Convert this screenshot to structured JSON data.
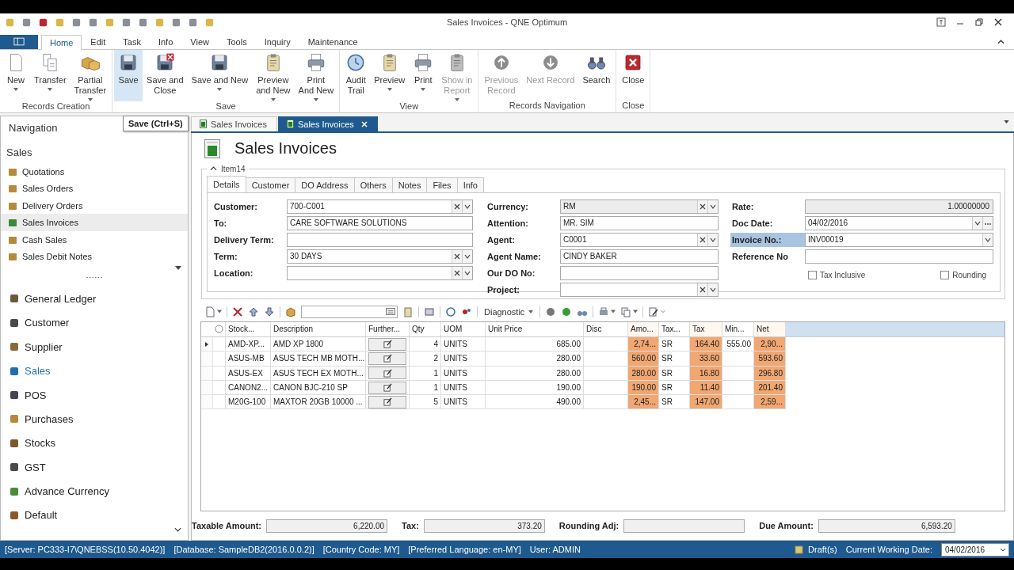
{
  "window": {
    "title": "Sales Invoices - QNE Optimum"
  },
  "ribbon_tabs": [
    {
      "label": "Home",
      "selected": true
    },
    {
      "label": "Edit",
      "selected": false
    },
    {
      "label": "Task",
      "selected": false
    },
    {
      "label": "Info",
      "selected": false
    },
    {
      "label": "View",
      "selected": false
    },
    {
      "label": "Tools",
      "selected": false
    },
    {
      "label": "Inquiry",
      "selected": false
    },
    {
      "label": "Maintenance",
      "selected": false
    }
  ],
  "ribbon_groups": [
    {
      "label": "Records Creation",
      "buttons": [
        {
          "lines": [
            "New"
          ],
          "dropdown": true,
          "disabled": false,
          "hovered": false
        },
        {
          "lines": [
            "Transfer"
          ],
          "dropdown": true,
          "disabled": false,
          "hovered": false
        },
        {
          "lines": [
            "Partial",
            "Transfer"
          ],
          "dropdown": true,
          "disabled": false,
          "hovered": false
        }
      ]
    },
    {
      "label": "Save",
      "buttons": [
        {
          "lines": [
            "Save"
          ],
          "dropdown": false,
          "disabled": false,
          "hovered": true
        },
        {
          "lines": [
            "Save and",
            "Close"
          ],
          "dropdown": false,
          "disabled": false,
          "hovered": false
        },
        {
          "lines": [
            "Save and New"
          ],
          "dropdown": true,
          "disabled": false,
          "hovered": false
        },
        {
          "lines": [
            "Preview",
            "and New"
          ],
          "dropdown": true,
          "disabled": false,
          "hovered": false
        },
        {
          "lines": [
            "Print",
            "And New"
          ],
          "dropdown": true,
          "disabled": false,
          "hovered": false
        }
      ]
    },
    {
      "label": "View",
      "buttons": [
        {
          "lines": [
            "Audit",
            "Trail"
          ],
          "dropdown": false,
          "disabled": false,
          "hovered": false
        },
        {
          "lines": [
            "Preview"
          ],
          "dropdown": true,
          "disabled": false,
          "hovered": false
        },
        {
          "lines": [
            "Print"
          ],
          "dropdown": true,
          "disabled": false,
          "hovered": false
        },
        {
          "lines": [
            "Show in",
            "Report"
          ],
          "dropdown": true,
          "disabled": true,
          "hovered": false
        }
      ]
    },
    {
      "label": "Records Navigation",
      "buttons": [
        {
          "lines": [
            "Previous",
            "Record"
          ],
          "dropdown": false,
          "disabled": true,
          "hovered": false
        },
        {
          "lines": [
            "Next Record"
          ],
          "dropdown": false,
          "disabled": true,
          "hovered": false
        },
        {
          "lines": [
            "Search"
          ],
          "dropdown": false,
          "disabled": false,
          "hovered": false
        }
      ]
    },
    {
      "label": "Close",
      "buttons": [
        {
          "lines": [
            "Close"
          ],
          "dropdown": false,
          "disabled": false,
          "hovered": false
        }
      ]
    }
  ],
  "tooltip": "Save (Ctrl+S)",
  "doc_tabs": [
    {
      "label": "Sales Invoices",
      "selected": false
    },
    {
      "label": "Sales Invoices",
      "selected": true
    }
  ],
  "navigation": {
    "title": "Navigation",
    "section": "Sales",
    "items": [
      {
        "label": "Quotations",
        "selected": false
      },
      {
        "label": "Sales Orders",
        "selected": false
      },
      {
        "label": "Delivery Orders",
        "selected": false
      },
      {
        "label": "Sales Invoices",
        "selected": true
      },
      {
        "label": "Cash Sales",
        "selected": false
      },
      {
        "label": "Sales Debit Notes",
        "selected": false
      }
    ],
    "modules": [
      {
        "label": "General Ledger",
        "selected": false
      },
      {
        "label": "Customer",
        "selected": false
      },
      {
        "label": "Supplier",
        "selected": false
      },
      {
        "label": "Sales",
        "selected": true
      },
      {
        "label": "POS",
        "selected": false
      },
      {
        "label": "Purchases",
        "selected": false
      },
      {
        "label": "Stocks",
        "selected": false
      },
      {
        "label": "GST",
        "selected": false
      },
      {
        "label": "Advance Currency",
        "selected": false
      },
      {
        "label": "Default",
        "selected": false
      }
    ]
  },
  "page_title": "Sales Invoices",
  "form": {
    "group_title": "Item14",
    "expanded": true,
    "tabs": [
      {
        "label": "Details",
        "selected": true
      },
      {
        "label": "Customer",
        "selected": false
      },
      {
        "label": "DO Address",
        "selected": false
      },
      {
        "label": "Others",
        "selected": false
      },
      {
        "label": "Notes",
        "selected": false
      },
      {
        "label": "Files",
        "selected": false
      },
      {
        "label": "Info",
        "selected": false
      }
    ],
    "columns": [
      [
        {
          "label": "Customer:",
          "value": "700-C001",
          "kind": "combo",
          "disabled": false,
          "highlighted": false
        },
        {
          "label": "To:",
          "value": "CARE SOFTWARE SOLUTIONS",
          "kind": "text",
          "disabled": false,
          "highlighted": false
        },
        {
          "label": "Delivery Term:",
          "kind": "text",
          "disabled": false,
          "highlighted": false
        },
        {
          "label": "Term:",
          "value": "30 DAYS",
          "kind": "combo",
          "disabled": false,
          "highlighted": false
        },
        {
          "label": "Location:",
          "kind": "combo",
          "disabled": false,
          "highlighted": false
        }
      ],
      [
        {
          "label": "Currency:",
          "value": "RM",
          "kind": "combo",
          "disabled": true,
          "highlighted": false
        },
        {
          "label": "Attention:",
          "value": "MR. SIM",
          "kind": "text",
          "disabled": false,
          "highlighted": false
        },
        {
          "label": "Agent:",
          "value": "C0001",
          "kind": "combo",
          "disabled": false,
          "highlighted": false
        },
        {
          "label": "Agent Name:",
          "value": "CINDY BAKER",
          "kind": "text",
          "disabled": false,
          "highlighted": false
        },
        {
          "label": "Our DO No:",
          "kind": "text",
          "disabled": false,
          "highlighted": false
        },
        {
          "label": "Project:",
          "kind": "combo",
          "disabled": false,
          "highlighted": false
        }
      ],
      [
        {
          "label": "Rate:",
          "value": "1.00000000",
          "kind": "number",
          "disabled": true,
          "highlighted": false
        },
        {
          "label": "Doc Date:",
          "value": "04/02/2016",
          "kind": "date",
          "disabled": false,
          "highlighted": false
        },
        {
          "label": "Invoice No.:",
          "value": "INV00019",
          "kind": "dropdown",
          "disabled": false,
          "highlighted": true
        },
        {
          "label": "Reference No",
          "kind": "text",
          "disabled": false,
          "highlighted": false
        }
      ]
    ],
    "checkboxes": [
      {
        "label": "Tax Inclusive",
        "checked": false
      },
      {
        "label": "Rounding",
        "checked": false
      }
    ]
  },
  "grid_toolbar": {
    "diagnostic": "Diagnostic"
  },
  "grid": {
    "columns": [
      {
        "label": "Stock...",
        "kind": "text",
        "highlight": false
      },
      {
        "label": "Description",
        "kind": "text",
        "highlight": false
      },
      {
        "label": "Further...",
        "kind": "button",
        "highlight": false
      },
      {
        "label": "Qty",
        "kind": "number",
        "highlight": false
      },
      {
        "label": "UOM",
        "kind": "text",
        "highlight": false
      },
      {
        "label": "Unit Price",
        "kind": "number",
        "highlight": false
      },
      {
        "label": "Disc",
        "kind": "number",
        "highlight": false
      },
      {
        "label": "Amo...",
        "kind": "number",
        "highlight": true
      },
      {
        "label": "Tax...",
        "kind": "text",
        "highlight": false
      },
      {
        "label": "Tax",
        "kind": "number",
        "highlight": true
      },
      {
        "label": "Min...",
        "kind": "number",
        "highlight": false
      },
      {
        "label": "Net",
        "kind": "number",
        "highlight": true
      }
    ],
    "rows": [
      {
        "current": true,
        "cells": [
          "AMD-XP...",
          "AMD XP 1800",
          "",
          "4",
          "UNITS",
          "685.00",
          "",
          "2,74...",
          "SR",
          "164.40",
          "555.00",
          "2,90..."
        ]
      },
      {
        "current": false,
        "cells": [
          "ASUS-MB",
          "ASUS TECH MB MOTH...",
          "",
          "2",
          "UNITS",
          "280.00",
          "",
          "560.00",
          "SR",
          "33.60",
          "",
          "593.60"
        ]
      },
      {
        "current": false,
        "cells": [
          "ASUS-EX",
          "ASUS TECH EX MOTH...",
          "",
          "1",
          "UNITS",
          "280.00",
          "",
          "280.00",
          "SR",
          "16.80",
          "",
          "296.80"
        ]
      },
      {
        "current": false,
        "cells": [
          "CANON2...",
          "CANON BJC-210 SP",
          "",
          "1",
          "UNITS",
          "190.00",
          "",
          "190.00",
          "SR",
          "11.40",
          "",
          "201.40"
        ]
      },
      {
        "current": false,
        "cells": [
          "M20G-100",
          "MAXTOR 20GB 10000 ...",
          "",
          "5",
          "UNITS",
          "490.00",
          "",
          "2,45...",
          "SR",
          "147.00",
          "",
          "2,59..."
        ]
      }
    ]
  },
  "totals": [
    {
      "label": "Taxable Amount:",
      "value": "6,220.00"
    },
    {
      "label": "Tax:",
      "value": "373.20"
    },
    {
      "label": "Rounding Adj:"
    },
    {
      "label": "Due Amount:",
      "value": "6,593.20"
    }
  ],
  "status_bar": {
    "items": [
      "[Server: PC333-I7\\QNEBSS(10.50.4042)]",
      "[Database: SampleDB2(2016.0.0.2)]",
      "[Country Code: MY]",
      "[Preferred Language: en-MY]",
      "User: ADMIN"
    ],
    "drafts": "Draft(s)",
    "date_label": "Current Working Date:",
    "date_value": "04/02/2016"
  }
}
